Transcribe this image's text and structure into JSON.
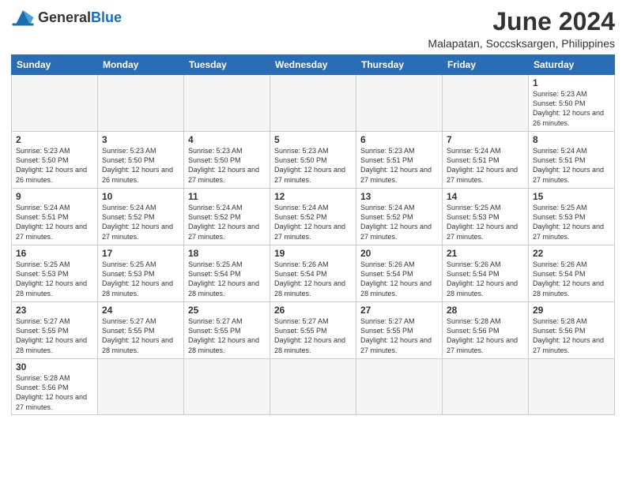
{
  "logo": {
    "text_general": "General",
    "text_blue": "Blue"
  },
  "header": {
    "month_title": "June 2024",
    "location": "Malapatan, Soccsksargen, Philippines"
  },
  "weekdays": [
    "Sunday",
    "Monday",
    "Tuesday",
    "Wednesday",
    "Thursday",
    "Friday",
    "Saturday"
  ],
  "weeks": [
    [
      {
        "day": "",
        "empty": true
      },
      {
        "day": "",
        "empty": true
      },
      {
        "day": "",
        "empty": true
      },
      {
        "day": "",
        "empty": true
      },
      {
        "day": "",
        "empty": true
      },
      {
        "day": "",
        "empty": true
      },
      {
        "day": "1",
        "sunrise": "5:23 AM",
        "sunset": "5:50 PM",
        "daylight": "12 hours and 26 minutes."
      }
    ],
    [
      {
        "day": "2",
        "sunrise": "5:23 AM",
        "sunset": "5:50 PM",
        "daylight": "12 hours and 26 minutes."
      },
      {
        "day": "3",
        "sunrise": "5:23 AM",
        "sunset": "5:50 PM",
        "daylight": "12 hours and 26 minutes."
      },
      {
        "day": "4",
        "sunrise": "5:23 AM",
        "sunset": "5:50 PM",
        "daylight": "12 hours and 27 minutes."
      },
      {
        "day": "5",
        "sunrise": "5:23 AM",
        "sunset": "5:50 PM",
        "daylight": "12 hours and 27 minutes."
      },
      {
        "day": "6",
        "sunrise": "5:23 AM",
        "sunset": "5:51 PM",
        "daylight": "12 hours and 27 minutes."
      },
      {
        "day": "7",
        "sunrise": "5:24 AM",
        "sunset": "5:51 PM",
        "daylight": "12 hours and 27 minutes."
      },
      {
        "day": "8",
        "sunrise": "5:24 AM",
        "sunset": "5:51 PM",
        "daylight": "12 hours and 27 minutes."
      }
    ],
    [
      {
        "day": "9",
        "sunrise": "5:24 AM",
        "sunset": "5:51 PM",
        "daylight": "12 hours and 27 minutes."
      },
      {
        "day": "10",
        "sunrise": "5:24 AM",
        "sunset": "5:52 PM",
        "daylight": "12 hours and 27 minutes."
      },
      {
        "day": "11",
        "sunrise": "5:24 AM",
        "sunset": "5:52 PM",
        "daylight": "12 hours and 27 minutes."
      },
      {
        "day": "12",
        "sunrise": "5:24 AM",
        "sunset": "5:52 PM",
        "daylight": "12 hours and 27 minutes."
      },
      {
        "day": "13",
        "sunrise": "5:24 AM",
        "sunset": "5:52 PM",
        "daylight": "12 hours and 27 minutes."
      },
      {
        "day": "14",
        "sunrise": "5:25 AM",
        "sunset": "5:53 PM",
        "daylight": "12 hours and 27 minutes."
      },
      {
        "day": "15",
        "sunrise": "5:25 AM",
        "sunset": "5:53 PM",
        "daylight": "12 hours and 27 minutes."
      }
    ],
    [
      {
        "day": "16",
        "sunrise": "5:25 AM",
        "sunset": "5:53 PM",
        "daylight": "12 hours and 28 minutes."
      },
      {
        "day": "17",
        "sunrise": "5:25 AM",
        "sunset": "5:53 PM",
        "daylight": "12 hours and 28 minutes."
      },
      {
        "day": "18",
        "sunrise": "5:25 AM",
        "sunset": "5:54 PM",
        "daylight": "12 hours and 28 minutes."
      },
      {
        "day": "19",
        "sunrise": "5:26 AM",
        "sunset": "5:54 PM",
        "daylight": "12 hours and 28 minutes."
      },
      {
        "day": "20",
        "sunrise": "5:26 AM",
        "sunset": "5:54 PM",
        "daylight": "12 hours and 28 minutes."
      },
      {
        "day": "21",
        "sunrise": "5:26 AM",
        "sunset": "5:54 PM",
        "daylight": "12 hours and 28 minutes."
      },
      {
        "day": "22",
        "sunrise": "5:26 AM",
        "sunset": "5:54 PM",
        "daylight": "12 hours and 28 minutes."
      }
    ],
    [
      {
        "day": "23",
        "sunrise": "5:27 AM",
        "sunset": "5:55 PM",
        "daylight": "12 hours and 28 minutes."
      },
      {
        "day": "24",
        "sunrise": "5:27 AM",
        "sunset": "5:55 PM",
        "daylight": "12 hours and 28 minutes."
      },
      {
        "day": "25",
        "sunrise": "5:27 AM",
        "sunset": "5:55 PM",
        "daylight": "12 hours and 28 minutes."
      },
      {
        "day": "26",
        "sunrise": "5:27 AM",
        "sunset": "5:55 PM",
        "daylight": "12 hours and 28 minutes."
      },
      {
        "day": "27",
        "sunrise": "5:27 AM",
        "sunset": "5:55 PM",
        "daylight": "12 hours and 27 minutes."
      },
      {
        "day": "28",
        "sunrise": "5:28 AM",
        "sunset": "5:56 PM",
        "daylight": "12 hours and 27 minutes."
      },
      {
        "day": "29",
        "sunrise": "5:28 AM",
        "sunset": "5:56 PM",
        "daylight": "12 hours and 27 minutes."
      }
    ],
    [
      {
        "day": "30",
        "sunrise": "5:28 AM",
        "sunset": "5:56 PM",
        "daylight": "12 hours and 27 minutes."
      },
      {
        "day": "",
        "empty": true
      },
      {
        "day": "",
        "empty": true
      },
      {
        "day": "",
        "empty": true
      },
      {
        "day": "",
        "empty": true
      },
      {
        "day": "",
        "empty": true
      },
      {
        "day": "",
        "empty": true
      }
    ]
  ]
}
